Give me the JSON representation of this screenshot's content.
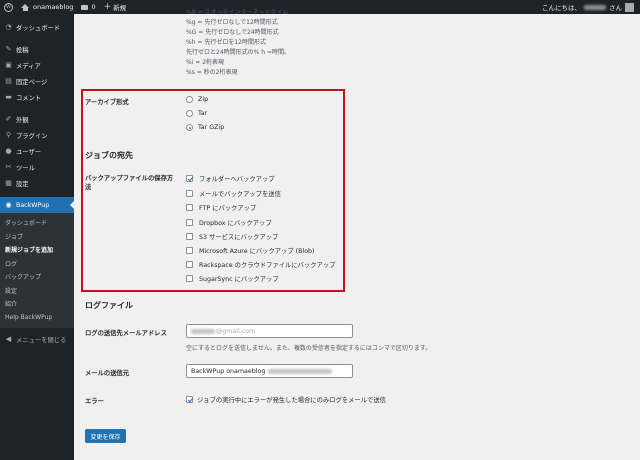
{
  "adminbar": {
    "site_name": "onamaeblog",
    "comments_count": "0",
    "new_label": "新規",
    "greeting_prefix": "こんにちは、",
    "greeting_suffix": "さん"
  },
  "sidebar": {
    "items": [
      {
        "label": "ダッシュボード",
        "icon": "dashboard-icon"
      },
      {
        "label": "投稿",
        "icon": "pin-icon"
      },
      {
        "label": "メディア",
        "icon": "media-icon"
      },
      {
        "label": "固定ページ",
        "icon": "page-icon"
      },
      {
        "label": "コメント",
        "icon": "comment-icon"
      },
      {
        "label": "外観",
        "icon": "brush-icon"
      },
      {
        "label": "プラグイン",
        "icon": "plugin-icon"
      },
      {
        "label": "ユーザー",
        "icon": "user-icon"
      },
      {
        "label": "ツール",
        "icon": "wrench-icon"
      },
      {
        "label": "設定",
        "icon": "settings-icon"
      }
    ],
    "current": {
      "label": "BackWPup",
      "icon": "backwpup-icon"
    },
    "submenu": [
      "ダッシュボード",
      "ジョブ",
      "新規ジョブを追加",
      "ログ",
      "バックアップ",
      "設定",
      "紹介",
      "Help BackWPup"
    ],
    "submenu_active": "新規ジョブを追加",
    "collapse_label": "メニューを閉じる"
  },
  "format_lines": [
    "%B = スオッチインターネットタイム",
    "%g = 先行ゼロなしで12時間形式",
    "%G = 先行ゼロなしで24時間形式",
    "%h = 先行ゼロを12時間形式",
    "先行ゼロと24時間形式の% h =時間。",
    "%i = 2桁表現",
    "%s = 秒の2桁表現"
  ],
  "archive": {
    "label": "アーカイブ形式",
    "options": [
      {
        "label": "Zip",
        "selected": false
      },
      {
        "label": "Tar",
        "selected": false
      },
      {
        "label": "Tar GZip",
        "selected": true
      }
    ]
  },
  "destinations": {
    "title": "ジョブの宛先",
    "label_line1": "バックアップファイルの保存方",
    "label_line2": "法",
    "options": [
      {
        "label": "フォルダーへバックアップ",
        "checked": true
      },
      {
        "label": "メールでバックアップを送信",
        "checked": false
      },
      {
        "label": "FTP にバックアップ",
        "checked": false
      },
      {
        "label": "Dropbox にバックアップ",
        "checked": false
      },
      {
        "label": "S3 サービスにバックアップ",
        "checked": false
      },
      {
        "label": "Microsoft Azure にバックアップ (Blob)",
        "checked": false
      },
      {
        "label": "Rackspace のクラウドファイルにバックアップ",
        "checked": false
      },
      {
        "label": "SugarSync にバックアップ",
        "checked": false
      }
    ]
  },
  "logfile": {
    "title": "ログファイル",
    "email_label": "ログの送信先メールアドレス",
    "email_value": "@gmail.com",
    "email_help": "空にするとログを送信しません。また、複数の受信者を指定するにはコンマで区切ります。",
    "sender_label": "メールの送信元",
    "sender_value": "BackWPup onamaeblog",
    "error_label": "エラー",
    "error_option": "ジョブの実行中にエラーが発生した場合にのみログをメールで送信",
    "error_checked": true
  },
  "save_button": "変更を保存",
  "colors": {
    "accent": "#2271b1",
    "highlight": "#c4111b",
    "sidebar_bg": "#1d2327",
    "content_bg": "#f0f0f1"
  }
}
